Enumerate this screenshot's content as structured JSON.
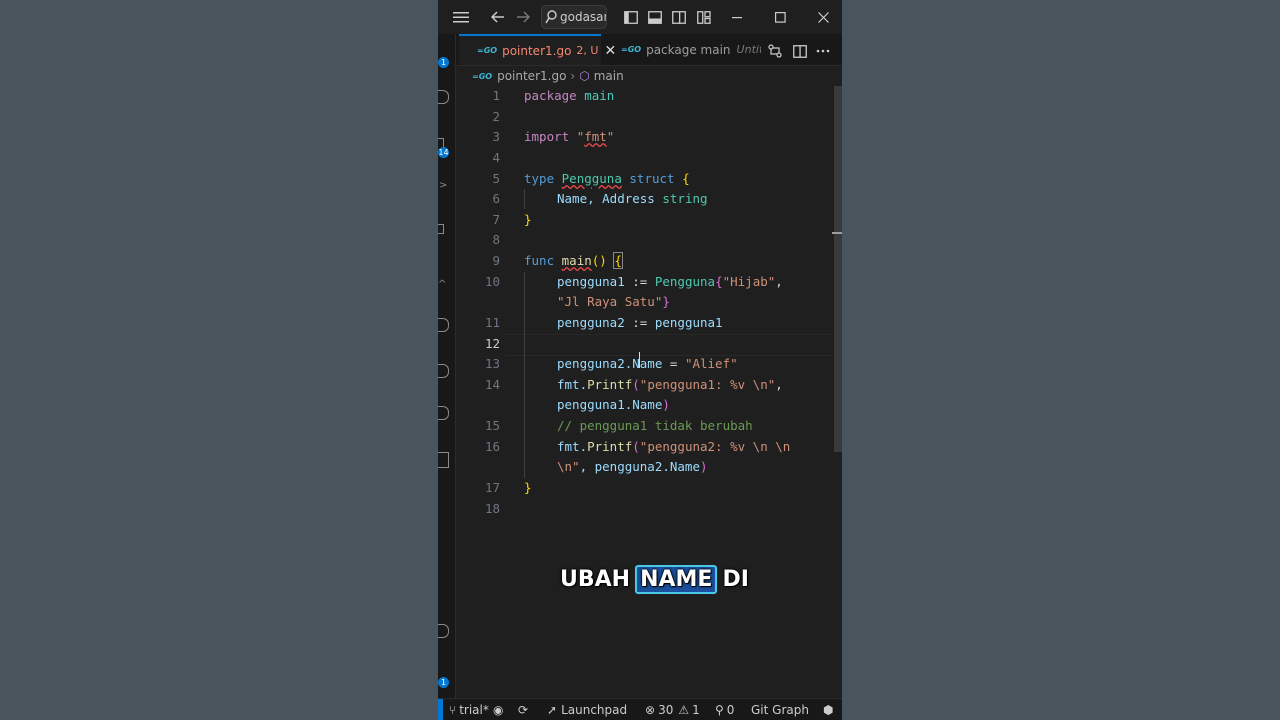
{
  "titlebar": {
    "search_text": "godasan",
    "icons": [
      "menu-icon",
      "arrow-left-icon",
      "arrow-right-icon",
      "search-icon",
      "layout-sidebar-icon",
      "layout-panel-icon",
      "layout-sidebar-right-icon",
      "customize-layout-icon",
      "minimize-icon",
      "maximize-icon",
      "close-icon"
    ]
  },
  "activity": {
    "badges": [
      "1",
      "14",
      "1"
    ]
  },
  "tabs": [
    {
      "label": "pointer1.go",
      "status": "2, U",
      "active": true
    },
    {
      "label": "package main",
      "extra": "Untitled"
    }
  ],
  "breadcrumb": {
    "file": "pointer1.go",
    "symbol": "main"
  },
  "editor": {
    "lines": [
      "1",
      "2",
      "3",
      "4",
      "5",
      "6",
      "7",
      "8",
      "9",
      "10",
      "",
      "11",
      "12",
      "13",
      "14",
      "",
      "15",
      "16",
      "",
      "17",
      "18"
    ],
    "current_line": "12"
  },
  "code": {
    "l1_kw": "package",
    "l1_name": "main",
    "l3_kw": "import",
    "l3_q1": "\"",
    "l3_pkg": "fmt",
    "l3_q2": "\"",
    "l5_kw": "type",
    "l5_name": "Pengguna",
    "l5_kw2": "struct",
    "l5_brace": "{",
    "l6_fields": "Name, Address",
    "l6_type": "string",
    "l7_brace": "}",
    "l9_kw": "func",
    "l9_fn": "main",
    "l9_parens": "()",
    "l9_brace": "{",
    "l10_var": "pengguna1",
    "l10_op": " := ",
    "l10_type": "Pengguna",
    "l10_open": "{",
    "l10_str": "\"Hijab\"",
    "l10_comma": ",",
    "l10b_str": "\"Jl Raya Satu\"",
    "l10b_close": "}",
    "l11_var": "pengguna2",
    "l11_op": " := ",
    "l11_var2": "pengguna1",
    "l13_var": "pengguna2.Name",
    "l13_op": " = ",
    "l13_str": "\"Alief\"",
    "l14_pkg": "fmt.",
    "l14_fn": "Printf",
    "l14_open": "(",
    "l14_str": "\"pengguna1: %v \\n\"",
    "l14_comma": ",",
    "l14b_var": "pengguna1.Name",
    "l14b_close": ")",
    "l15_comment": "// pengguna1 tidak berubah",
    "l16_pkg": "fmt.",
    "l16_fn": "Printf",
    "l16_open": "(",
    "l16_str": "\"pengguna2: %v \\n \\n",
    "l16b_str": "\\n\"",
    "l16b_rest": ", pengguna2.Name",
    "l16b_close": ")",
    "l17_brace": "}"
  },
  "caption": {
    "word1": "UBAH",
    "word2": "NAME",
    "word3": "DI"
  },
  "statusbar": {
    "branch": "trial*",
    "launchpad": "Launchpad",
    "errors": "30",
    "warnings": "1",
    "ports": "0",
    "gitgraph": "Git Graph"
  },
  "colors": {
    "accent": "#0078d4",
    "background": "#4a545c",
    "editor_bg": "#1f1f1f",
    "highlight": "#1a4f9c"
  }
}
